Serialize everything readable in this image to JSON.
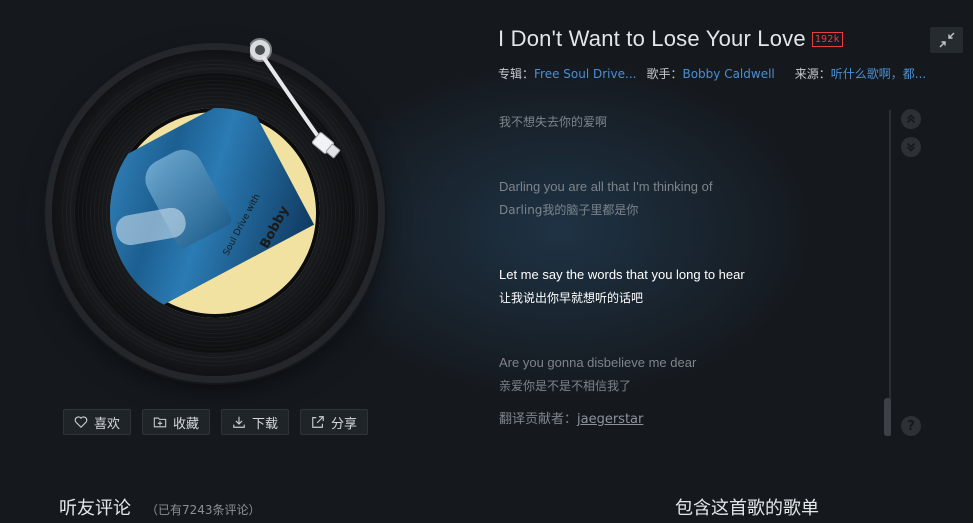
{
  "song": {
    "title": "I Don't Want to Lose Your Love",
    "quality": "192k",
    "album_label": "专辑：",
    "album": "Free Soul Drive...",
    "artist_label": "歌手：",
    "artist": "Bobby Caldwell",
    "source_label": "来源：",
    "source": "听什么歌啊，都..."
  },
  "cover": {
    "text_main": "Bobby",
    "text_sub": "Soul Drive with"
  },
  "actions": {
    "like": "喜欢",
    "collect": "收藏",
    "download": "下载",
    "share": "分享"
  },
  "lyrics": [
    {
      "text": "我不想失去你的爱啊",
      "lang": "cn",
      "active": false
    },
    {
      "text": "Darling you are all that I'm thinking of",
      "lang": "en",
      "active": false
    },
    {
      "text": "Darling我的脑子里都是你",
      "lang": "cn",
      "active": false
    },
    {
      "text": "Let me say the words that you long to hear",
      "lang": "en",
      "active": true
    },
    {
      "text": "让我说出你早就想听的话吧",
      "lang": "cn",
      "active": true
    },
    {
      "text": "Are you gonna disbelieve me dear",
      "lang": "en",
      "active": false
    },
    {
      "text": "亲爱你是不是不相信我了",
      "lang": "cn",
      "active": false
    }
  ],
  "contributor": {
    "label": "翻译贡献者：",
    "name": "jaegerstar"
  },
  "comments": {
    "title": "听友评论",
    "count_text": "（已有7243条评论）"
  },
  "playlists": {
    "title": "包含这首歌的歌单"
  },
  "icons": {
    "like": "heart-icon",
    "collect": "folder-add-icon",
    "download": "download-icon",
    "share": "share-icon",
    "collapse": "collapse-icon",
    "scroll_up": "double-chevron-up-icon",
    "scroll_down": "double-chevron-down-icon",
    "help": "help-icon"
  },
  "colors": {
    "background": "#15191e",
    "link": "#4b8fd1",
    "quality_badge": "#e34040",
    "active_lyric": "#ffffff",
    "inactive_lyric": "#7d848a"
  }
}
